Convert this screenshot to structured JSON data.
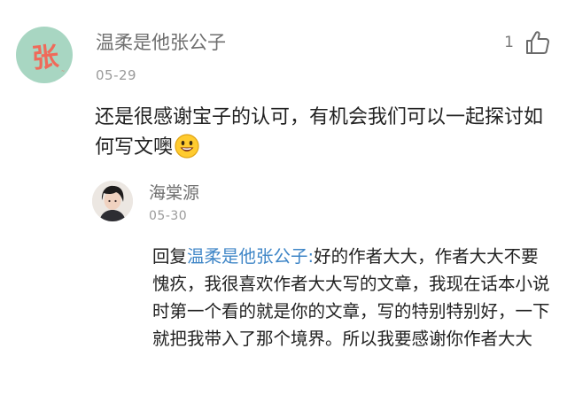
{
  "comment": {
    "avatar": {
      "icon": "avatar-zhang-icon",
      "glyph": "张",
      "background": "#a8d6c2",
      "glyph_color": "#f06a5a"
    },
    "username": "温柔是他张公子",
    "date": "05-29",
    "like_count": "1",
    "like_icon": "thumbs-up-icon",
    "text": "还是很感谢宝子的认可，有机会我们可以一起探讨如何写文噢",
    "emoji": "smile-emoji-icon"
  },
  "reply": {
    "avatar": {
      "icon": "avatar-photo-icon"
    },
    "username": "海棠源",
    "date": "05-30",
    "prefix": "回复",
    "mention": "温柔是他张公子:",
    "text": "好的作者大大，作者大大不要愧疚，我很喜欢作者大大写的文章，我现在话本小说时第一个看的就是你的文章，写的特别特别好，一下就把我带入了那个境界。所以我要感谢你作者大大"
  },
  "colors": {
    "mention": "#3f86c7",
    "meta_text": "#9a9a9a",
    "username_text": "#6f6f6f",
    "body_text": "#222222"
  }
}
